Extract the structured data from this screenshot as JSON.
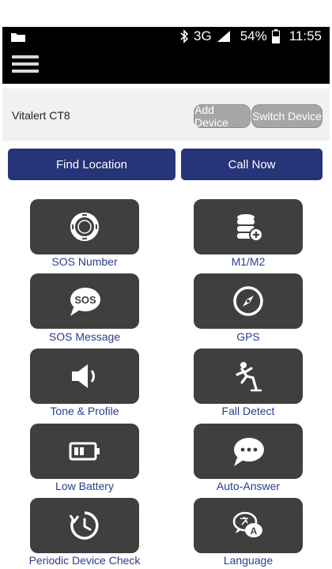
{
  "status": {
    "time": "11:55",
    "battery": "54%",
    "network": "3G"
  },
  "device": {
    "name": "Vitalert CT8",
    "add_label": "Add Device",
    "switch_label": "Switch Device"
  },
  "actions": {
    "find": "Find Location",
    "call": "Call Now"
  },
  "tiles": [
    {
      "label": "SOS Number",
      "icon": "lifebuoy-icon"
    },
    {
      "label": "M1/M2",
      "icon": "database-add-icon"
    },
    {
      "label": "SOS Message",
      "icon": "sos-bubble-icon"
    },
    {
      "label": "GPS",
      "icon": "compass-icon"
    },
    {
      "label": "Tone & Profile",
      "icon": "speaker-icon"
    },
    {
      "label": "Fall Detect",
      "icon": "falling-person-icon"
    },
    {
      "label": "Low Battery",
      "icon": "low-battery-icon"
    },
    {
      "label": "Auto-Answer",
      "icon": "chat-dots-icon"
    },
    {
      "label": "Periodic Device Check",
      "icon": "clock-refresh-icon"
    },
    {
      "label": "Language",
      "icon": "language-bubble-icon"
    }
  ],
  "colors": {
    "primary": "#263478",
    "tile": "#3f3f3f",
    "label": "#2b3c8a",
    "pill": "#a6a6a6"
  }
}
